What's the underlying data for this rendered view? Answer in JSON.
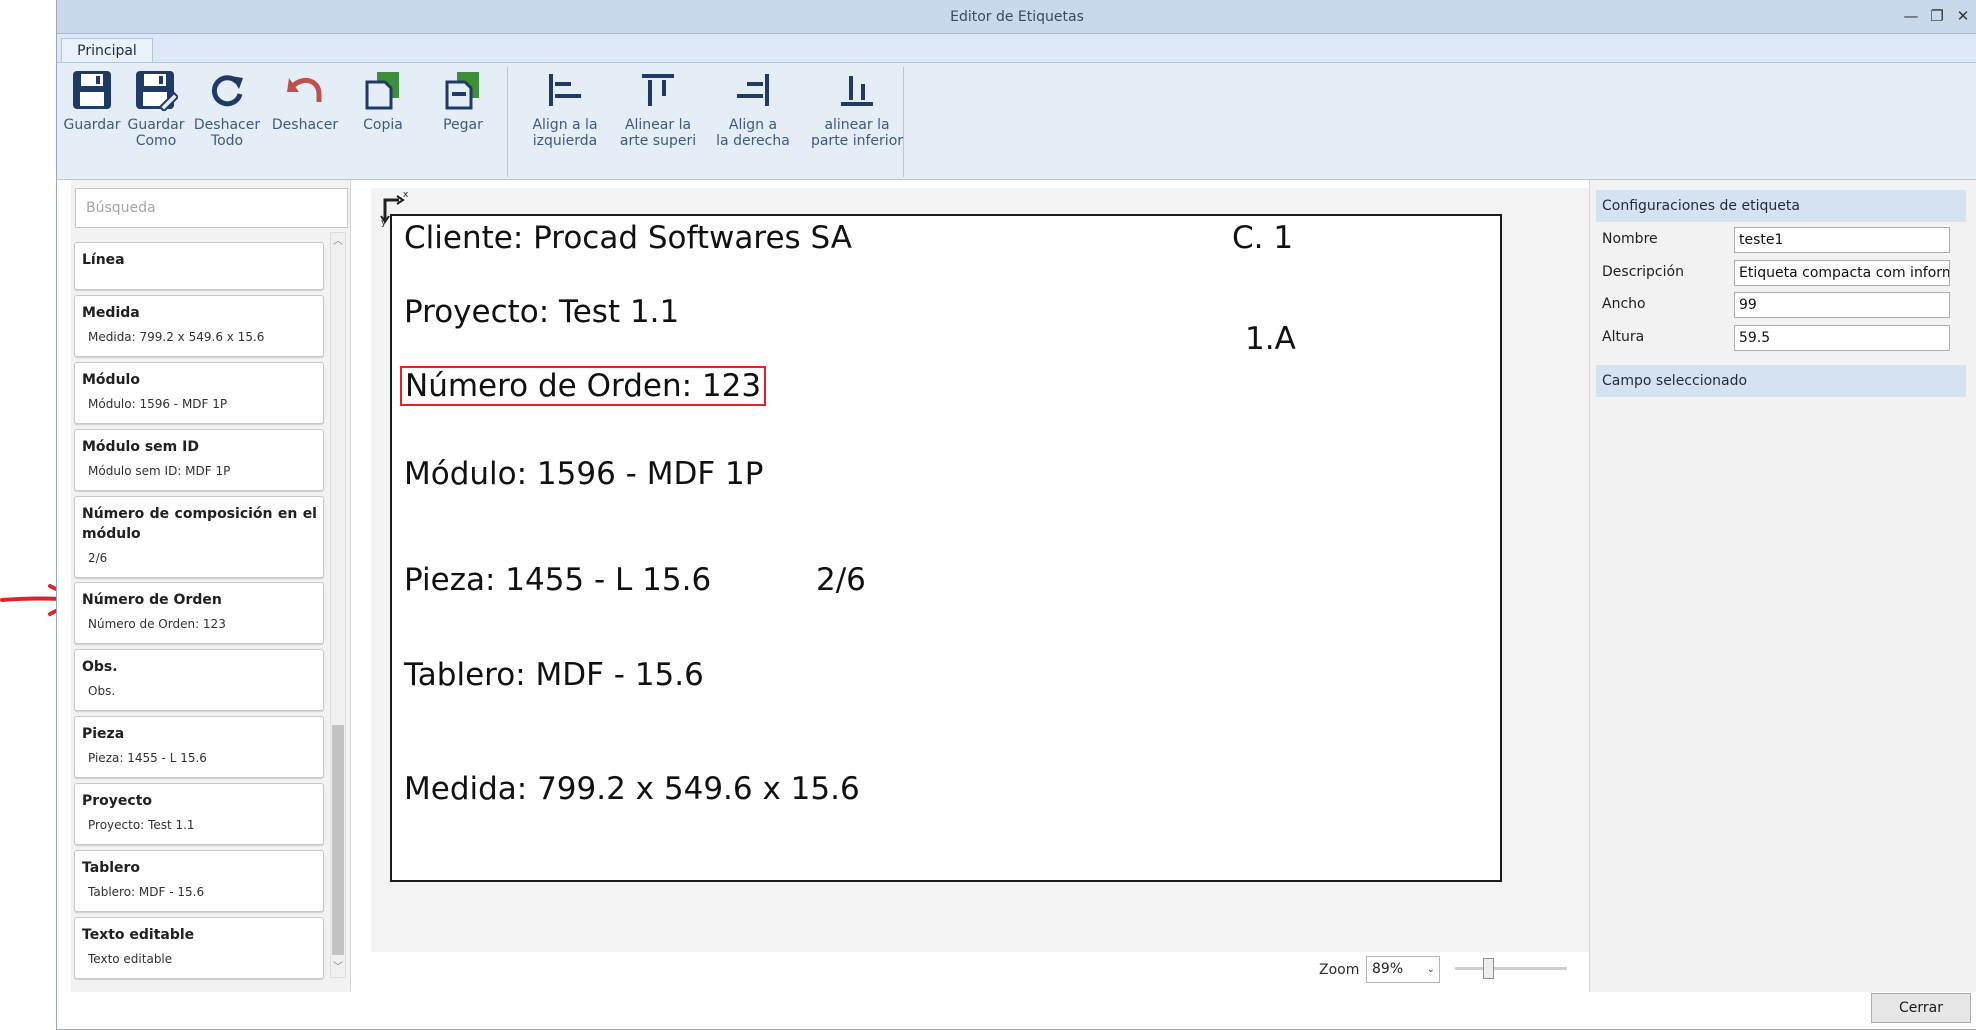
{
  "window": {
    "title": "Editor de Etiquetas",
    "minimize_glyph": "—",
    "restore_glyph": "❐",
    "close_glyph": "✕"
  },
  "ribbon": {
    "tab_label": "Principal",
    "buttons": [
      {
        "label1": "Guardar",
        "label2": "",
        "icon": "save-icon"
      },
      {
        "label1": "Guardar",
        "label2": "Como",
        "icon": "save-as-icon"
      },
      {
        "label1": "Deshacer",
        "label2": "Todo",
        "icon": "redo-all-icon"
      },
      {
        "label1": "Deshacer",
        "label2": "",
        "icon": "undo-icon"
      },
      {
        "label1": "Copia",
        "label2": "",
        "icon": "copy-icon"
      },
      {
        "label1": "Pegar",
        "label2": "",
        "icon": "paste-icon"
      },
      {
        "label1": "Align a la",
        "label2": "izquierda",
        "icon": "align-left-icon"
      },
      {
        "label1": "Alinear la",
        "label2": "arte superi",
        "icon": "align-top-icon"
      },
      {
        "label1": "Align a",
        "label2": "la derecha",
        "icon": "align-right-icon"
      },
      {
        "label1": "alinear la",
        "label2": "parte inferior",
        "icon": "align-bottom-icon"
      }
    ]
  },
  "fields_panel": {
    "search_placeholder": "Búsqueda",
    "scroll_up_glyph": "︿",
    "scroll_down_glyph": "﹀",
    "items": [
      {
        "title": "Línea",
        "value": ""
      },
      {
        "title": "Medida",
        "value": "Medida: 799.2 x 549.6 x 15.6"
      },
      {
        "title": "Módulo",
        "value": "Módulo: 1596 - MDF 1P"
      },
      {
        "title": "Módulo sem ID",
        "value": "Módulo sem ID: MDF 1P"
      },
      {
        "title": "Número de composición en el módulo",
        "value": "2/6"
      },
      {
        "title": "Número de Orden",
        "value": "Número de Orden: 123"
      },
      {
        "title": "Obs.",
        "value": "Obs."
      },
      {
        "title": "Pieza",
        "value": "Pieza: 1455 - L 15.6"
      },
      {
        "title": "Proyecto",
        "value": "Proyecto: Test 1.1"
      },
      {
        "title": "Tablero",
        "value": "Tablero: MDF - 15.6"
      },
      {
        "title": "Texto editable",
        "value": "Texto editable"
      }
    ]
  },
  "label_canvas": {
    "origin_axis_label": "x",
    "origin_axis_label_y": "y",
    "texts": {
      "cliente": "Cliente: Procad Softwares SA",
      "c1": "C. 1",
      "proyecto": "Proyecto: Test 1.1",
      "one_a": "1.A",
      "orden": "Número de Orden: 123",
      "modulo": "Módulo: 1596 - MDF 1P",
      "pieza": "Pieza: 1455 - L 15.6",
      "composicion": "2/6",
      "tablero": "Tablero: MDF - 15.6",
      "medida": "Medida: 799.2 x 549.6 x 15.6"
    },
    "selected_color": "#e0232b"
  },
  "zoom": {
    "label": "Zoom",
    "value": "89%",
    "arrow_glyph": "⌄",
    "slider_fraction": 0.3
  },
  "properties_panel": {
    "label_settings_title": "Configuraciones de etiqueta",
    "fields": [
      {
        "label": "Nombre",
        "value": "teste1"
      },
      {
        "label": "Descripción",
        "value": "Etiqueta compacta com informa"
      },
      {
        "label": "Ancho",
        "value": "99"
      },
      {
        "label": "Altura",
        "value": "59.5"
      }
    ],
    "selected_field_title": "Campo seleccionado"
  },
  "footer": {
    "close_label": "Cerrar"
  },
  "annotation": {
    "arrow_color": "#e0232b"
  }
}
